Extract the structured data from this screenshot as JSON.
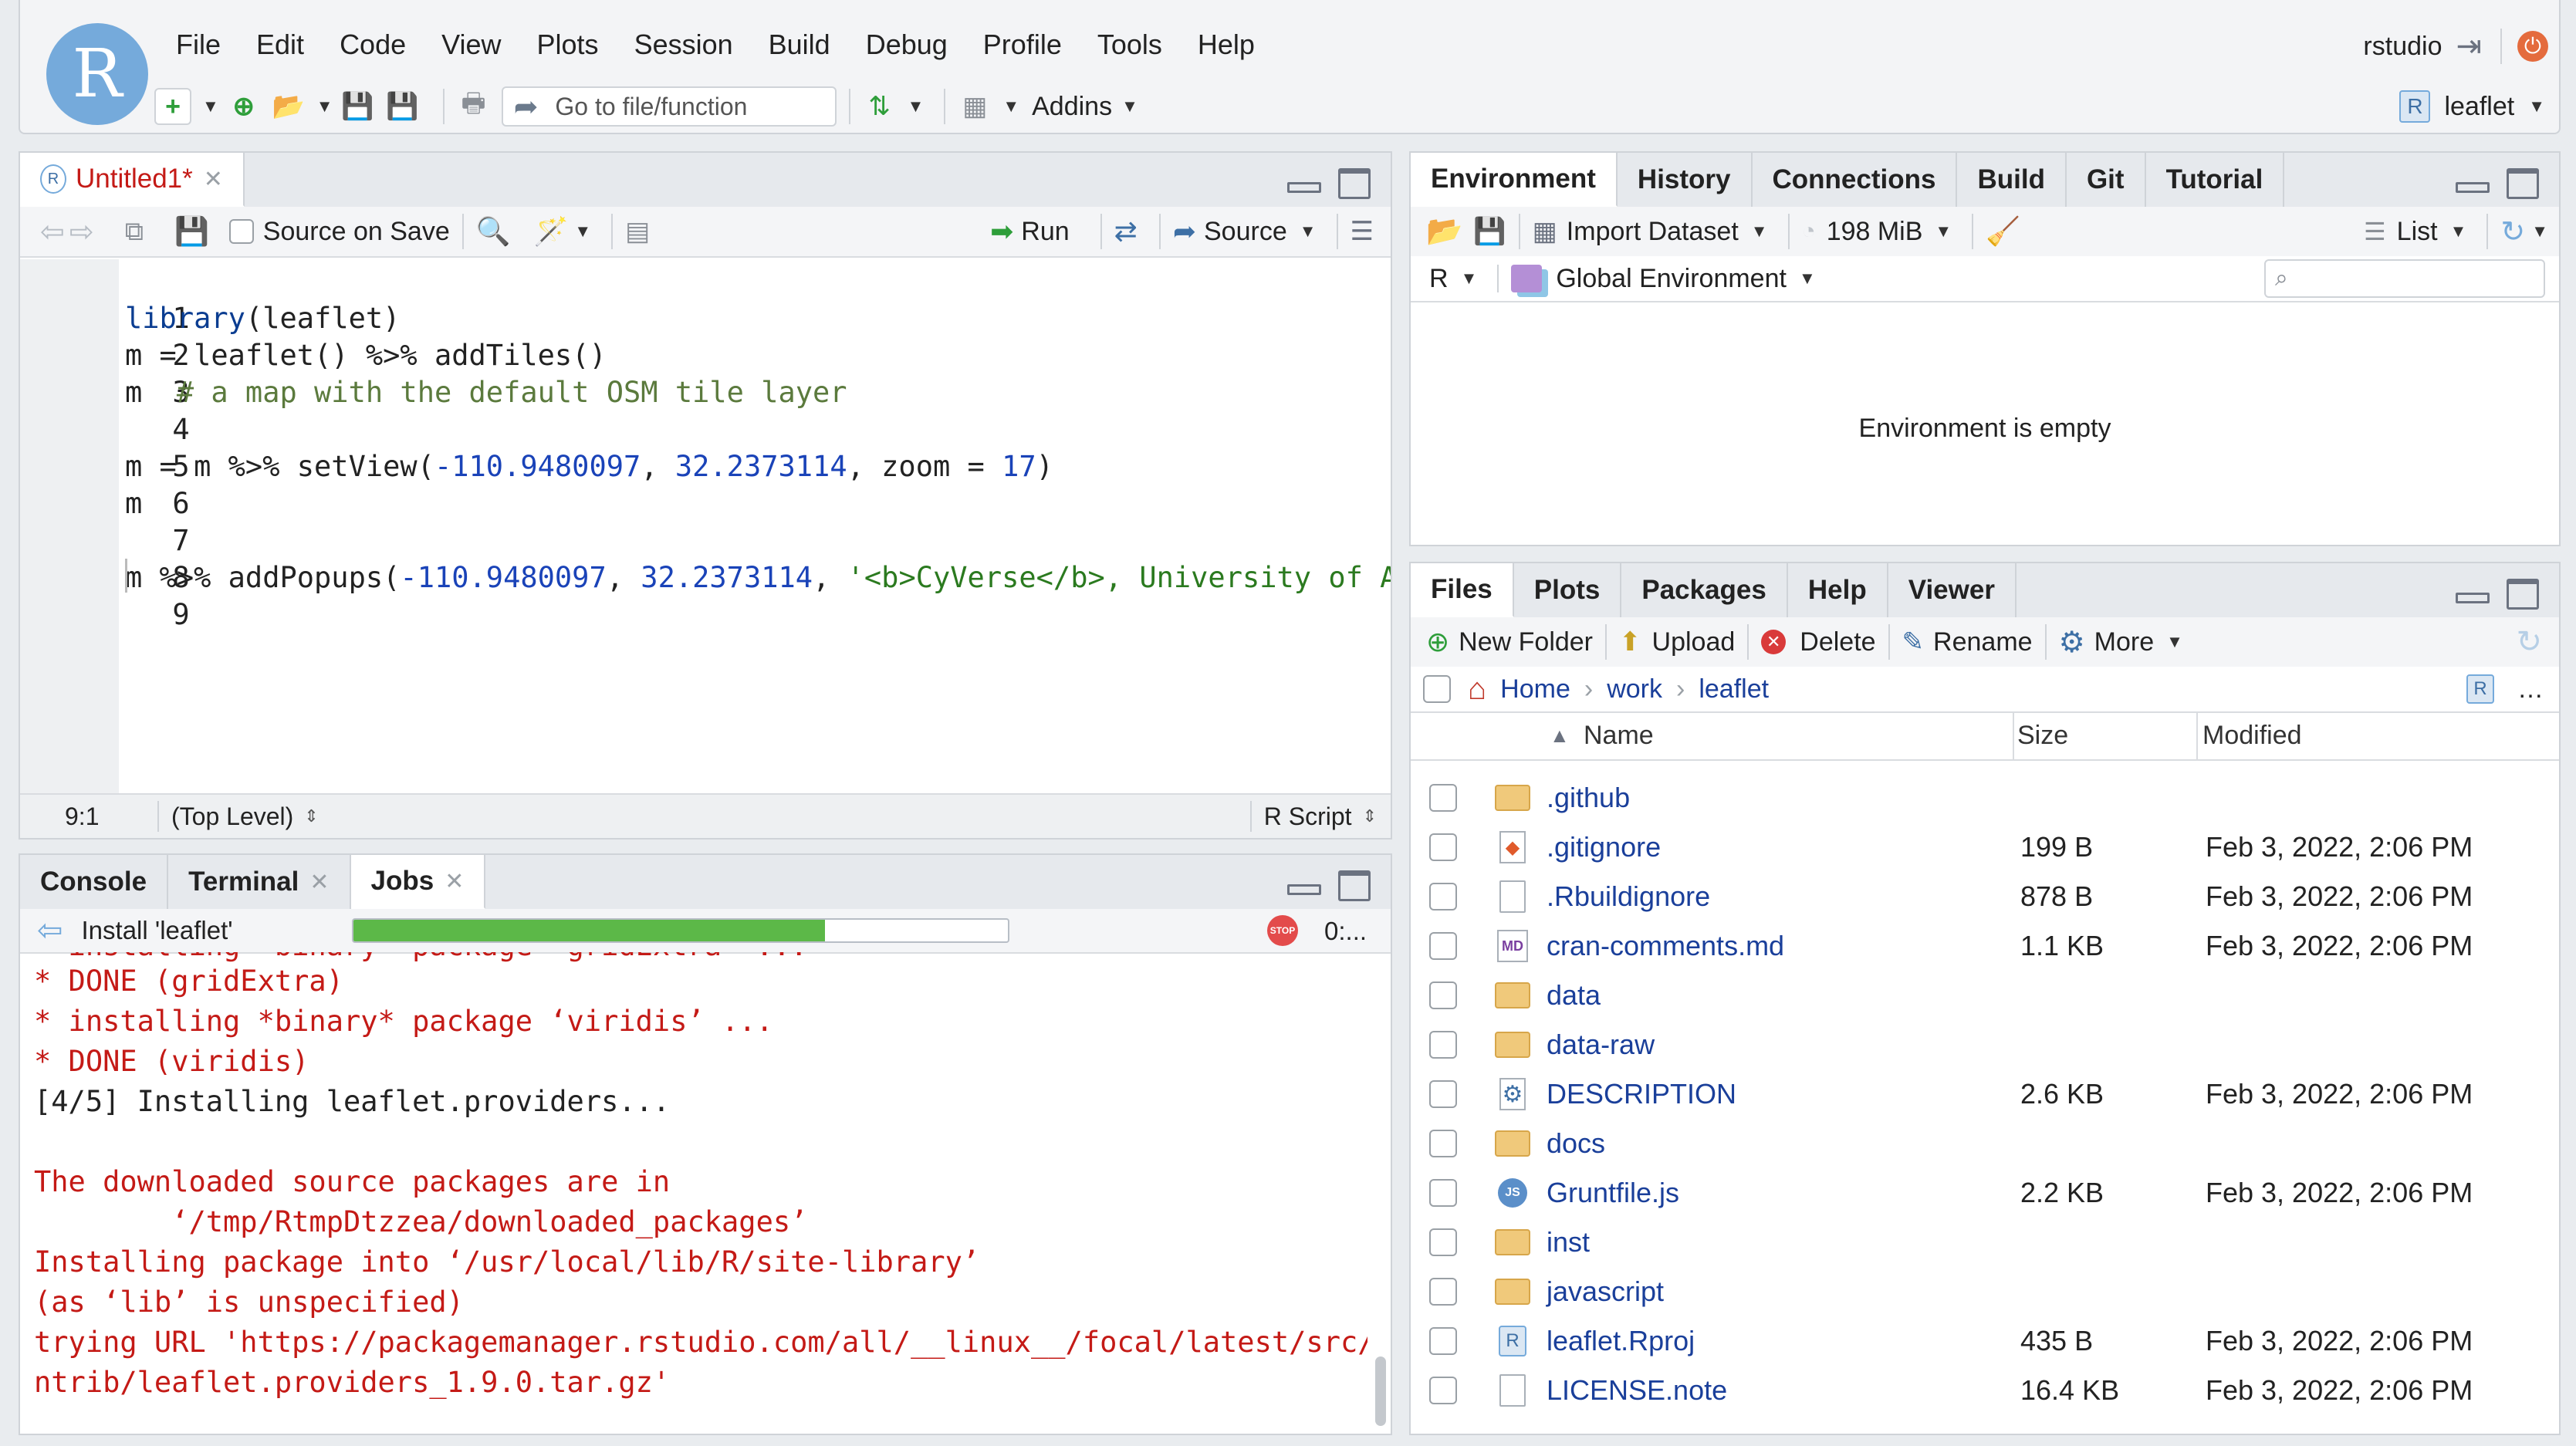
{
  "app": {
    "logo_letter": "R",
    "user": "rstudio",
    "project": "leaflet"
  },
  "menu": [
    "File",
    "Edit",
    "Code",
    "View",
    "Plots",
    "Session",
    "Build",
    "Debug",
    "Profile",
    "Tools",
    "Help"
  ],
  "toolbar": {
    "goto_placeholder": "Go to file/function",
    "addins": "Addins"
  },
  "editor": {
    "tab": "Untitled1*",
    "source_on_save": "Source on Save",
    "run": "Run",
    "source": "Source",
    "lines": [
      {
        "n": "1",
        "text": "library(leaflet)"
      },
      {
        "n": "2",
        "text": "m = leaflet() %>% addTiles()"
      },
      {
        "n": "3",
        "text": "m  # a map with the default OSM tile layer"
      },
      {
        "n": "4",
        "text": ""
      },
      {
        "n": "5",
        "text": "m = m %>% setView(-110.9480097, 32.2373114, zoom = 17)"
      },
      {
        "n": "6",
        "text": "m"
      },
      {
        "n": "7",
        "text": ""
      },
      {
        "n": "8",
        "text": "m %>% addPopups(-110.9480097, 32.2373114, '<b>CyVerse</b>, University of Ari"
      },
      {
        "n": "9",
        "text": ""
      }
    ],
    "status_pos": "9:1",
    "status_scope": "(Top Level)",
    "status_type": "R Script"
  },
  "console": {
    "tabs": [
      "Console",
      "Terminal",
      "Jobs"
    ],
    "job_title": "Install 'leaflet'",
    "job_progress": 0.72,
    "job_time": "0:...",
    "lines": [
      {
        "text": "* installing *binary* package ‘gridExtra’ ...",
        "color": "red"
      },
      {
        "text": "* DONE (gridExtra)",
        "color": "red"
      },
      {
        "text": "* installing *binary* package ‘viridis’ ...",
        "color": "red"
      },
      {
        "text": "* DONE (viridis)",
        "color": "red"
      },
      {
        "text": "[4/5] Installing leaflet.providers...",
        "color": "blk"
      },
      {
        "text": "",
        "color": "blk"
      },
      {
        "text": "The downloaded source packages are in",
        "color": "red"
      },
      {
        "text": "        ‘/tmp/RtmpDtzzea/downloaded_packages’",
        "color": "red"
      },
      {
        "text": "Installing package into ‘/usr/local/lib/R/site-library’",
        "color": "red"
      },
      {
        "text": "(as ‘lib’ is unspecified)",
        "color": "red"
      },
      {
        "text": "trying URL 'https://packagemanager.rstudio.com/all/__linux__/focal/latest/src/co",
        "color": "red"
      },
      {
        "text": "ntrib/leaflet.providers_1.9.0.tar.gz'",
        "color": "red"
      }
    ]
  },
  "environment": {
    "tabs": [
      "Environment",
      "History",
      "Connections",
      "Build",
      "Git",
      "Tutorial"
    ],
    "import_dataset": "Import Dataset",
    "memory": "198 MiB",
    "view_mode": "List",
    "language": "R",
    "scope": "Global Environment",
    "empty_message": "Environment is empty"
  },
  "files": {
    "tabs": [
      "Files",
      "Plots",
      "Packages",
      "Help",
      "Viewer"
    ],
    "actions": {
      "new_folder": "New Folder",
      "upload": "Upload",
      "delete": "Delete",
      "rename": "Rename",
      "more": "More"
    },
    "breadcrumb": [
      "Home",
      "work",
      "leaflet"
    ],
    "columns": {
      "name": "Name",
      "size": "Size",
      "modified": "Modified"
    },
    "rows": [
      {
        "name": ".github",
        "size": "",
        "modified": "",
        "icon": "folder"
      },
      {
        "name": ".gitignore",
        "size": "199 B",
        "modified": "Feb 3, 2022, 2:06 PM",
        "icon": "git"
      },
      {
        "name": ".Rbuildignore",
        "size": "878 B",
        "modified": "Feb 3, 2022, 2:06 PM",
        "icon": "doc"
      },
      {
        "name": "cran-comments.md",
        "size": "1.1 KB",
        "modified": "Feb 3, 2022, 2:06 PM",
        "icon": "md"
      },
      {
        "name": "data",
        "size": "",
        "modified": "",
        "icon": "folder"
      },
      {
        "name": "data-raw",
        "size": "",
        "modified": "",
        "icon": "folder"
      },
      {
        "name": "DESCRIPTION",
        "size": "2.6 KB",
        "modified": "Feb 3, 2022, 2:06 PM",
        "icon": "gear"
      },
      {
        "name": "docs",
        "size": "",
        "modified": "",
        "icon": "folder"
      },
      {
        "name": "Gruntfile.js",
        "size": "2.2 KB",
        "modified": "Feb 3, 2022, 2:06 PM",
        "icon": "js"
      },
      {
        "name": "inst",
        "size": "",
        "modified": "",
        "icon": "folder"
      },
      {
        "name": "javascript",
        "size": "",
        "modified": "",
        "icon": "folder"
      },
      {
        "name": "leaflet.Rproj",
        "size": "435 B",
        "modified": "Feb 3, 2022, 2:06 PM",
        "icon": "rproj"
      },
      {
        "name": "LICENSE.note",
        "size": "16.4 KB",
        "modified": "Feb 3, 2022, 2:06 PM",
        "icon": "doc"
      }
    ]
  }
}
